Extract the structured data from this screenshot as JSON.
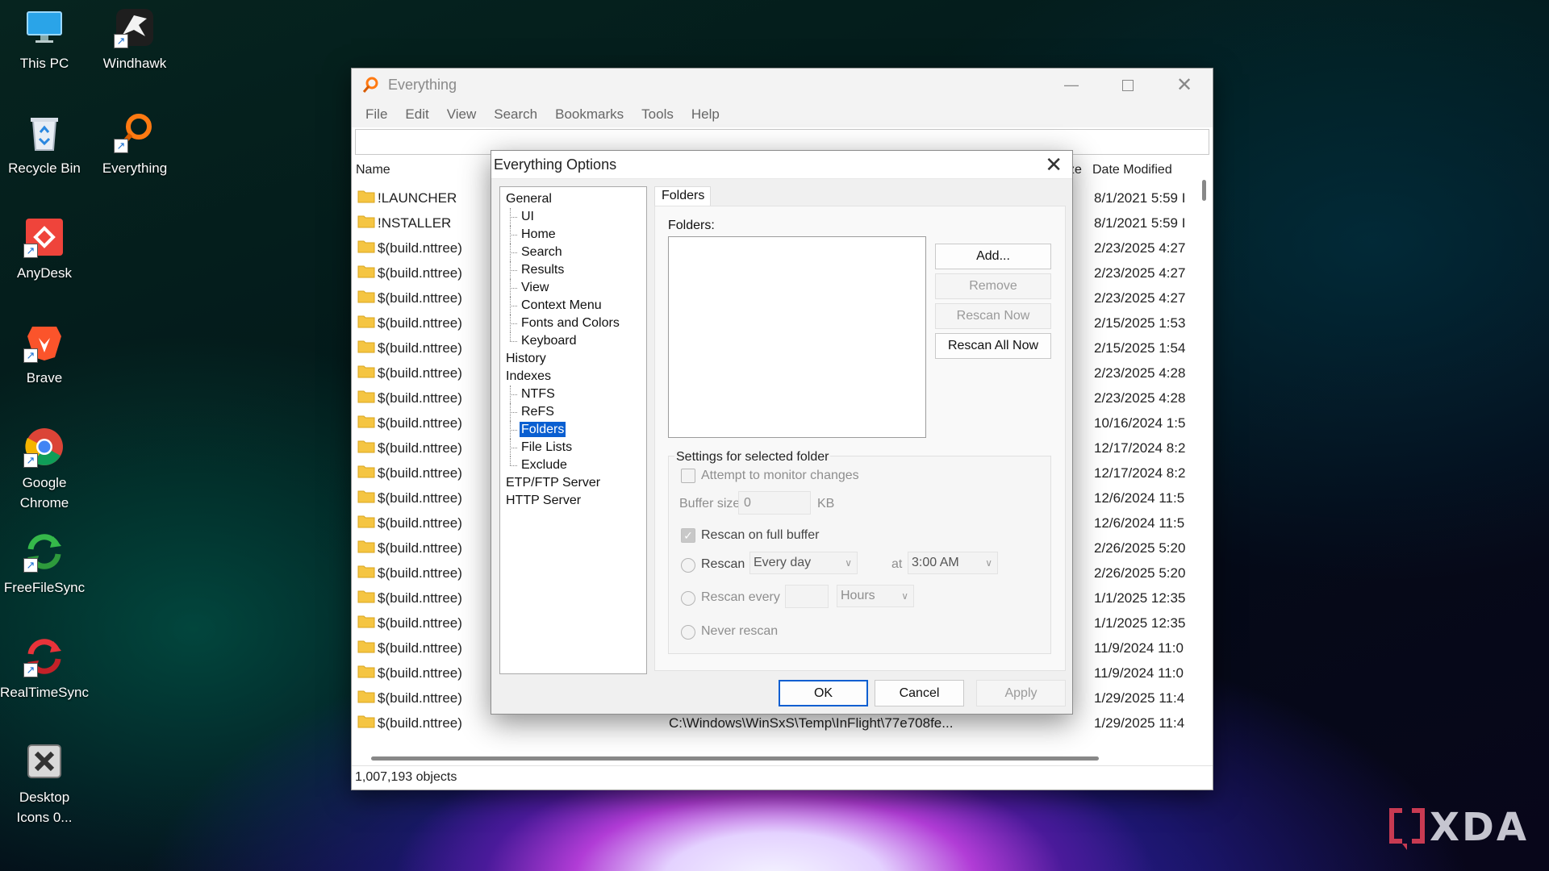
{
  "desktop": {
    "icons": [
      {
        "label": "This PC",
        "icon": "monitor-icon"
      },
      {
        "label": "Windhawk",
        "icon": "hawk-icon"
      },
      {
        "label": "Recycle Bin",
        "icon": "recycle-bin-icon"
      },
      {
        "label": "Everything",
        "icon": "everything-search-icon"
      },
      {
        "label": "AnyDesk",
        "icon": "anydesk-icon"
      },
      {
        "label": "Brave",
        "icon": "brave-lion-icon"
      },
      {
        "label": "Google Chrome",
        "icon": "chrome-icon"
      },
      {
        "label": "FreeFileSync",
        "icon": "sync-arrows-icon"
      },
      {
        "label": "RealTimeSync",
        "icon": "realtime-sync-icon"
      },
      {
        "label": "Desktop Icons 0...",
        "icon": "desktop-icons-icon"
      }
    ],
    "watermark": "XDA"
  },
  "window": {
    "title": "Everything",
    "menu": [
      "File",
      "Edit",
      "View",
      "Search",
      "Bookmarks",
      "Tools",
      "Help"
    ],
    "search_value": "",
    "columns": {
      "name": "Name",
      "size": "ze",
      "date": "Date Modified"
    },
    "rows": [
      {
        "name": "!LAUNCHER",
        "path": "",
        "date": "8/1/2021 5:59 I"
      },
      {
        "name": "!NSTALLER",
        "path": "",
        "date": "8/1/2021 5:59 I"
      },
      {
        "name": "$(build.nttree)",
        "path": "",
        "date": "2/23/2025 4:27"
      },
      {
        "name": "$(build.nttree)",
        "path": "",
        "date": "2/23/2025 4:27"
      },
      {
        "name": "$(build.nttree)",
        "path": "",
        "date": "2/23/2025 4:27"
      },
      {
        "name": "$(build.nttree)",
        "path": "",
        "date": "2/15/2025 1:53"
      },
      {
        "name": "$(build.nttree)",
        "path": "",
        "date": "2/15/2025 1:54"
      },
      {
        "name": "$(build.nttree)",
        "path": "",
        "date": "2/23/2025 4:28"
      },
      {
        "name": "$(build.nttree)",
        "path": "",
        "date": "2/23/2025 4:28"
      },
      {
        "name": "$(build.nttree)",
        "path": "",
        "date": "10/16/2024 1:5"
      },
      {
        "name": "$(build.nttree)",
        "path": "",
        "date": "12/17/2024 8:2"
      },
      {
        "name": "$(build.nttree)",
        "path": "",
        "date": "12/17/2024 8:2"
      },
      {
        "name": "$(build.nttree)",
        "path": "",
        "date": "12/6/2024 11:5"
      },
      {
        "name": "$(build.nttree)",
        "path": "",
        "date": "12/6/2024 11:5"
      },
      {
        "name": "$(build.nttree)",
        "path": "",
        "date": "2/26/2025 5:20"
      },
      {
        "name": "$(build.nttree)",
        "path": "",
        "date": "2/26/2025 5:20"
      },
      {
        "name": "$(build.nttree)",
        "path": "",
        "date": "1/1/2025 12:35"
      },
      {
        "name": "$(build.nttree)",
        "path": "",
        "date": "1/1/2025 12:35"
      },
      {
        "name": "$(build.nttree)",
        "path": "",
        "date": "11/9/2024 11:0"
      },
      {
        "name": "$(build.nttree)",
        "path": "",
        "date": "11/9/2024 11:0"
      },
      {
        "name": "$(build.nttree)",
        "path": "",
        "date": "1/29/2025 11:4"
      },
      {
        "name": "$(build.nttree)",
        "path": "C:\\Windows\\WinSxS\\Temp\\InFlight\\77e708fe...",
        "date": "1/29/2025 11:4"
      }
    ],
    "status": "1,007,193 objects"
  },
  "dialog": {
    "title": "Everything Options",
    "tree": [
      {
        "label": "General",
        "level": 0
      },
      {
        "label": "UI",
        "level": 1
      },
      {
        "label": "Home",
        "level": 1
      },
      {
        "label": "Search",
        "level": 1
      },
      {
        "label": "Results",
        "level": 1
      },
      {
        "label": "View",
        "level": 1
      },
      {
        "label": "Context Menu",
        "level": 1
      },
      {
        "label": "Fonts and Colors",
        "level": 1
      },
      {
        "label": "Keyboard",
        "level": 1
      },
      {
        "label": "History",
        "level": 0
      },
      {
        "label": "Indexes",
        "level": 0
      },
      {
        "label": "NTFS",
        "level": 1
      },
      {
        "label": "ReFS",
        "level": 1
      },
      {
        "label": "Folders",
        "level": 1,
        "selected": true
      },
      {
        "label": "File Lists",
        "level": 1
      },
      {
        "label": "Exclude",
        "level": 1
      },
      {
        "label": "ETP/FTP Server",
        "level": 0
      },
      {
        "label": "HTTP Server",
        "level": 0
      }
    ],
    "tab": "Folders",
    "folders_label": "Folders:",
    "buttons": {
      "add": "Add...",
      "remove": "Remove",
      "rescan_now": "Rescan Now",
      "rescan_all_now": "Rescan All Now"
    },
    "settings": {
      "group_title": "Settings for selected folder",
      "monitor_changes": "Attempt to monitor changes",
      "buffer_size_label": "Buffer size:",
      "buffer_size_value": "0",
      "buffer_unit": "KB",
      "rescan_full_buffer": "Rescan on full buffer",
      "rescan_label": "Rescan",
      "rescan_frequency": "Every day",
      "at_label": "at",
      "rescan_time": "3:00 AM",
      "rescan_every_label": "Rescan every",
      "rescan_every_value": "",
      "rescan_every_unit": "Hours",
      "never_rescan": "Never rescan"
    },
    "footer": {
      "ok": "OK",
      "cancel": "Cancel",
      "apply": "Apply"
    }
  }
}
